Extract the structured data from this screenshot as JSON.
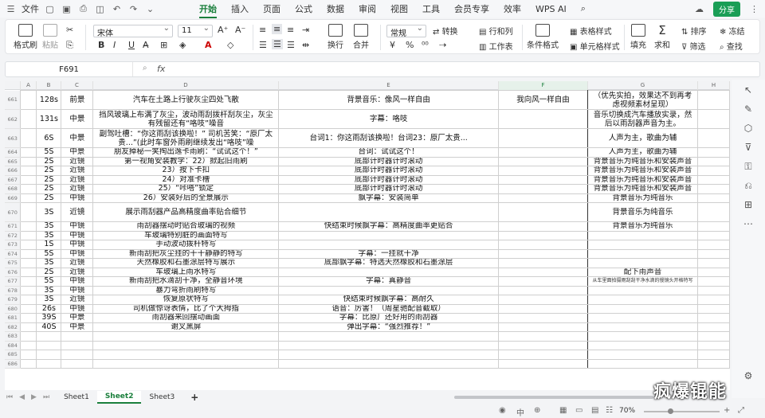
{
  "titlebar": {
    "file_label": "文件",
    "tabs": [
      "开始",
      "插入",
      "页面",
      "公式",
      "数据",
      "审阅",
      "视图",
      "工具",
      "会员专享",
      "效率",
      "WPS AI"
    ],
    "active_tab": "开始",
    "share_label": "分享"
  },
  "ribbon": {
    "format_painter": "格式刷",
    "paste": "粘贴",
    "font_name": "宋体",
    "font_size": "11",
    "bold": "B",
    "italic": "I",
    "underline": "U",
    "wrap": "换行",
    "merge": "合并",
    "number_format": "常规",
    "convert": "转换",
    "rows_cols": "行和列",
    "worksheet": "工作表",
    "cond_format": "条件格式",
    "table_style": "表格样式",
    "cell_style": "单元格样式",
    "fill": "填充",
    "sum": "求和",
    "sort": "排序",
    "filter": "筛选",
    "freeze": "冻结",
    "find": "查找",
    "currency": "¥",
    "percent": "%"
  },
  "formula_bar": {
    "cell_ref": "F691",
    "fx": "fx"
  },
  "sheet": {
    "columns": [
      "A",
      "B",
      "C",
      "D",
      "E",
      "F",
      "G",
      "H"
    ],
    "selected_column": "F",
    "rows": [
      {
        "n": "661",
        "b": "128s",
        "c": "前景",
        "d": "汽车在土路上行驶灰尘四处飞散",
        "e": "背景音乐：像风一样自由",
        "f": "我向风一样自由",
        "g": "（优先实拍，效果达不到再考虑视频素材呈现）"
      },
      {
        "n": "662",
        "b": "131s",
        "c": "中景",
        "d": "挡风玻璃上布满了灰尘，波动雨刮拨杆刮灰尘，灰尘有残留还有“咯吱”噪音",
        "e": "字幕：咯吱",
        "f": "",
        "g": "音乐切换成汽车播放实录，然后以雨刮器声音为主。"
      },
      {
        "n": "663",
        "b": "6S",
        "c": "中景",
        "d": "副驾吐槽：“你这雨刮该换啦！” 司机苦笑：“原厂太贵...”(此时车窗外雨刷继续发出“咯吱”噪",
        "e": "台词1：你这雨刮该换啦！台词23：原厂太贵...",
        "f": "",
        "g": "人声为主，歌曲为辅"
      },
      {
        "n": "664",
        "b": "5S",
        "c": "中景",
        "d": "朋友掉秘一笑掏出逸卡雨刷：“试试这个！”",
        "e": "台词：试试这个！",
        "f": "",
        "g": "人声为主，歌曲为辅"
      },
      {
        "n": "665",
        "b": "2S",
        "c": "近镜",
        "d": "第一视角安装教学：22）掀起旧雨刷",
        "e": "底部计时器计时滚动",
        "f": "",
        "g": "背景音乐为纯音乐和安装声音"
      },
      {
        "n": "666",
        "b": "2S",
        "c": "近镜",
        "d": "23）按下卡扣",
        "e": "底部计时器计时滚动",
        "f": "",
        "g": "背景音乐为纯音乐和安装声音"
      },
      {
        "n": "667",
        "b": "2S",
        "c": "近镜",
        "d": "24）对准卡槽",
        "e": "底部计时器计时滚动",
        "f": "",
        "g": "背景音乐为纯音乐和安装声音"
      },
      {
        "n": "668",
        "b": "2S",
        "c": "近镜",
        "d": "25）“咔嗒”锁定",
        "e": "底部计时器计时滚动",
        "f": "",
        "g": "背景音乐为纯音乐和安装声音"
      },
      {
        "n": "669",
        "b": "2S",
        "c": "中镜",
        "d": "26）安装好后的全景展示",
        "e": "飘字幕：安装简单",
        "f": "",
        "g": "背景音乐为纯音乐"
      },
      {
        "n": "670",
        "b": "3S",
        "c": "近镜",
        "d": "展示雨刮器产品高精度曲率贴合细节",
        "e": "",
        "f": "",
        "g": "背景音乐为纯音乐"
      },
      {
        "n": "671",
        "b": "3S",
        "c": "中镜",
        "d": "雨刮器摆动时贴合玻璃的视频",
        "e": "快结束时候飘字幕：高精度曲率更贴合",
        "f": "",
        "g": "背景音乐为纯音乐"
      },
      {
        "n": "672",
        "b": "3S",
        "c": "中镜",
        "d": "车玻璃特别脏的画面特写",
        "e": "",
        "f": "",
        "g": ""
      },
      {
        "n": "673",
        "b": "1S",
        "c": "中镜",
        "d": "手动波动拨杆特写",
        "e": "",
        "f": "",
        "g": ""
      },
      {
        "n": "674",
        "b": "5S",
        "c": "中镜",
        "d": "新雨刮把灰尘挂的干干静静的特写",
        "e": "字幕：一挂就干净",
        "f": "",
        "g": ""
      },
      {
        "n": "675",
        "b": "3S",
        "c": "近镜",
        "d": "天然橡胶和石墨涂层特写展示",
        "e": "底部飘字幕：特选天然橡胶和石墨涂层",
        "f": "",
        "g": ""
      },
      {
        "n": "676",
        "b": "2S",
        "c": "近镜",
        "d": "车玻璃上雨水特写",
        "e": "",
        "f": "",
        "g": "配下雨声音"
      },
      {
        "n": "677",
        "b": "5S",
        "c": "中镜",
        "d": "新雨刮把水滴刮干净，全静音环境",
        "e": "字幕：真静音",
        "f": "",
        "g": "从车里面拍摄雨刮刮干净水滴的慢镜头开格特写"
      },
      {
        "n": "678",
        "b": "3S",
        "c": "中镜",
        "d": "暴力弯折雨刷特写",
        "e": "",
        "f": "",
        "g": ""
      },
      {
        "n": "679",
        "b": "3S",
        "c": "近镜",
        "d": "恢复原状特写",
        "e": "快结束时候飘字幕：高耐久",
        "f": "",
        "g": ""
      },
      {
        "n": "680",
        "b": "26s",
        "c": "中镜",
        "d": "司机做惊讶表情，比了个大拇指",
        "e": "语音：厉害！（周星驰配音截取）",
        "f": "",
        "g": ""
      },
      {
        "n": "681",
        "b": "39S",
        "c": "中景",
        "d": "雨刮器来回摆动画面",
        "e": "字幕：比原厂还好用的雨刮器",
        "f": "",
        "g": ""
      },
      {
        "n": "682",
        "b": "40S",
        "c": "中景",
        "d": "谢叉黑屏",
        "e": "弹出字幕：“强烈推荐！”",
        "f": "",
        "g": ""
      },
      {
        "n": "683",
        "b": "",
        "c": "",
        "d": "",
        "e": "",
        "f": "",
        "g": ""
      },
      {
        "n": "684",
        "b": "",
        "c": "",
        "d": "",
        "e": "",
        "f": "",
        "g": ""
      },
      {
        "n": "685",
        "b": "",
        "c": "",
        "d": "",
        "e": "",
        "f": "",
        "g": ""
      },
      {
        "n": "686",
        "b": "",
        "c": "",
        "d": "",
        "e": "",
        "f": "",
        "g": ""
      }
    ]
  },
  "sheet_tabs": [
    "Sheet1",
    "Sheet2",
    "Sheet3"
  ],
  "active_sheet": "Sheet2",
  "add_sheet": "+",
  "status": {
    "zoom": "70%"
  },
  "watermark": "疯爆锟能",
  "icons": {
    "undo": "undo-icon",
    "redo": "redo-icon",
    "save": "save-icon",
    "print": "print-icon",
    "search": "search-icon",
    "more": "more-icon"
  }
}
